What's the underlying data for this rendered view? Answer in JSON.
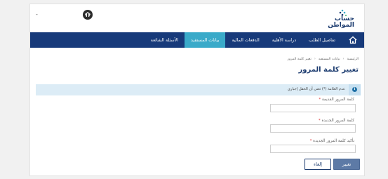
{
  "header": {
    "logo_line1": "حساب",
    "logo_line2": "المواطن",
    "user_menu": "-"
  },
  "nav": {
    "home_icon": "home-icon",
    "items": [
      {
        "label": "تفاصيل الطلب",
        "active": false
      },
      {
        "label": "دراسة الأهلية",
        "active": false
      },
      {
        "label": "الدفعات المالية",
        "active": false
      },
      {
        "label": "بيانات المستفيد",
        "active": true
      },
      {
        "label": "الأسئلة الشائعة",
        "active": false
      }
    ]
  },
  "breadcrumb": {
    "home": "الرئيسية",
    "parent": "بيانات المستفيد",
    "current": "تغيير كلمة المرور"
  },
  "page_title": "تغيير كلمة المرور",
  "alert": {
    "icon": "info-icon",
    "text": "عدم العلامة (*) تعني أن الحقل إجباري"
  },
  "form": {
    "old_password_label": "كلمة المرور القديمة",
    "new_password_label": "كلمة المرور الجديدة",
    "confirm_password_label": "تأكيد كلمة المرور الجديدة",
    "required_mark": "*",
    "old_password_value": "",
    "new_password_value": "",
    "confirm_password_value": ""
  },
  "buttons": {
    "change": "تغيير",
    "cancel": "إلغاء"
  },
  "colors": {
    "navbar": "#173a7a",
    "nav_active": "#3aaac9",
    "title": "#1b3b6f",
    "alert_bg": "#dcecf6",
    "primary_button": "#5d7aa6"
  }
}
